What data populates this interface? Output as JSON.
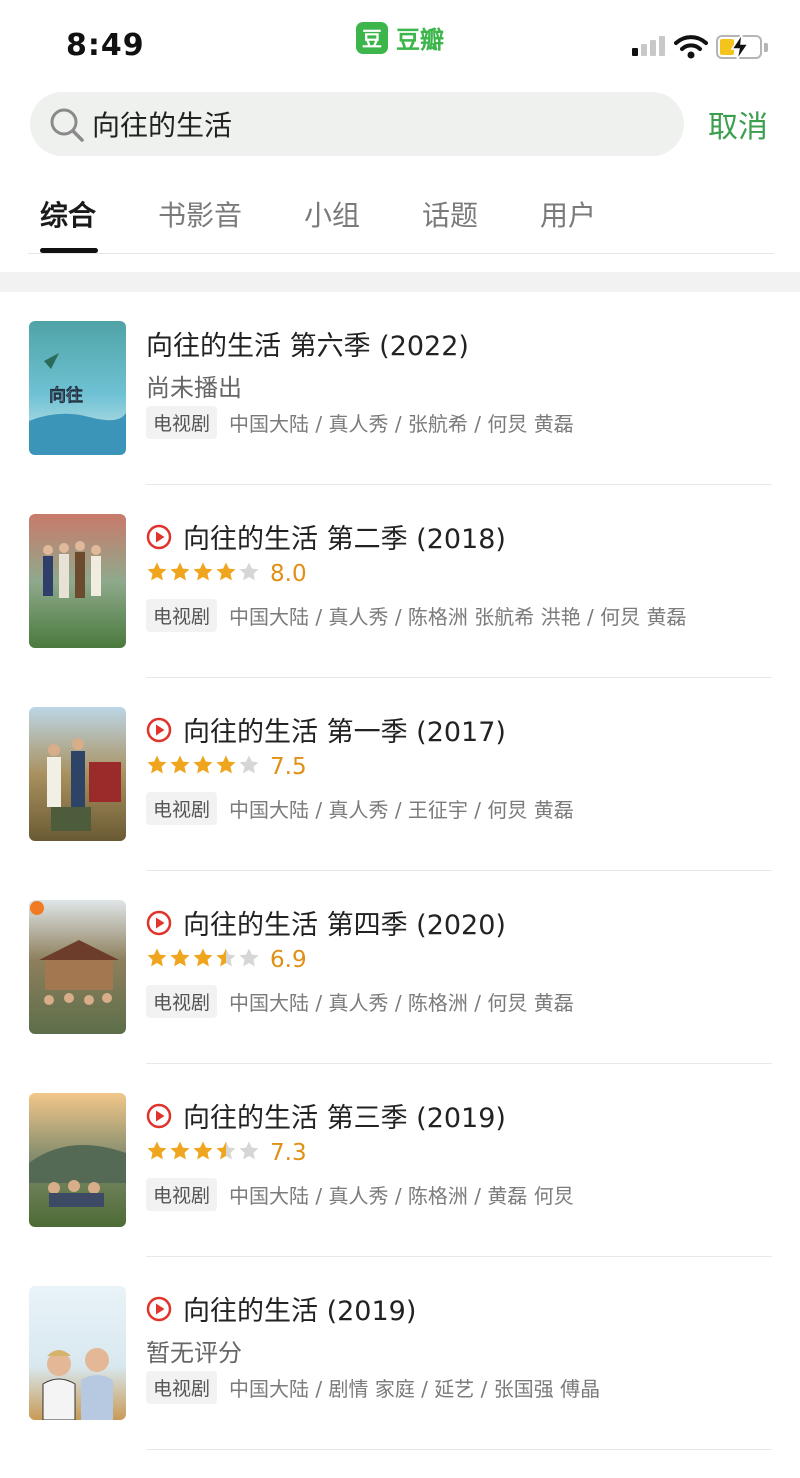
{
  "status_bar": {
    "time": "8:49",
    "app_logo_glyph": "豆",
    "app_name": "豆瓣",
    "icons": [
      "cellular-signal-icon",
      "wifi-icon",
      "battery-charging-icon"
    ]
  },
  "search": {
    "value": "向往的生活",
    "placeholder": "",
    "icon": "search-icon",
    "cancel_label": "取消"
  },
  "tabs": [
    {
      "label": "综合",
      "active": true
    },
    {
      "label": "书影音",
      "active": false
    },
    {
      "label": "小组",
      "active": false
    },
    {
      "label": "话题",
      "active": false
    },
    {
      "label": "用户",
      "active": false
    }
  ],
  "colors": {
    "accent_green": "#3cb54a",
    "cancel_green": "#3c9f4e",
    "play_red": "#e0332b",
    "star_gold": "#f0a51f",
    "star_gray": "#d6d6d6"
  },
  "results": [
    {
      "title": "向往的生活 第六季 (2022)",
      "playable": false,
      "rating": null,
      "stars": null,
      "status": "尚未播出",
      "type": "电视剧",
      "meta": "中国大陆 / 真人秀 / 张航希 / 何炅 黄磊"
    },
    {
      "title": "向往的生活 第二季 (2018)",
      "playable": true,
      "rating": "8.0",
      "stars": 4,
      "status": null,
      "type": "电视剧",
      "meta": "中国大陆 / 真人秀 / 陈格洲 张航希 洪艳 / 何炅 黄磊"
    },
    {
      "title": "向往的生活 第一季 (2017)",
      "playable": true,
      "rating": "7.5",
      "stars": 4,
      "status": null,
      "type": "电视剧",
      "meta": "中国大陆 / 真人秀 / 王征宇 / 何炅 黄磊"
    },
    {
      "title": "向往的生活 第四季 (2020)",
      "playable": true,
      "rating": "6.9",
      "stars": 3.5,
      "status": null,
      "type": "电视剧",
      "meta": "中国大陆 / 真人秀 / 陈格洲 / 何炅 黄磊"
    },
    {
      "title": "向往的生活 第三季 (2019)",
      "playable": true,
      "rating": "7.3",
      "stars": 3.5,
      "status": null,
      "type": "电视剧",
      "meta": "中国大陆 / 真人秀 / 陈格洲 / 黄磊 何炅"
    },
    {
      "title": "向往的生活 (2019)",
      "playable": true,
      "rating": null,
      "stars": null,
      "status": "暂无评分",
      "type": "电视剧",
      "meta": "中国大陆 / 剧情 家庭 / 延艺 / 张国强 傅晶"
    }
  ]
}
